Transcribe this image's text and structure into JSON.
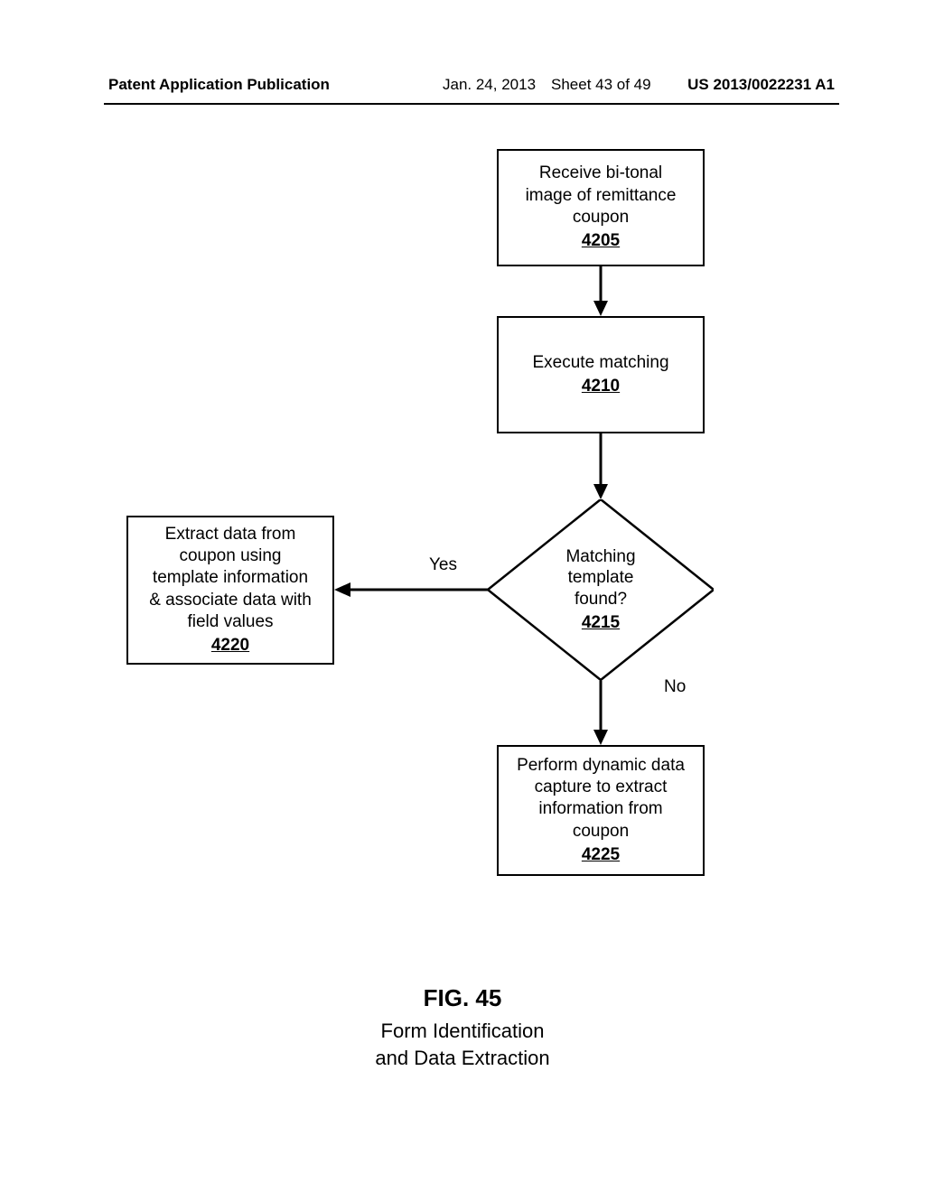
{
  "header": {
    "publication_label": "Patent Application Publication",
    "date": "Jan. 24, 2013",
    "sheet": "Sheet 43 of 49",
    "pubnum": "US 2013/0022231 A1"
  },
  "figure": {
    "number": "FIG. 45",
    "title_line1": "Form Identification",
    "title_line2": "and Data Extraction"
  },
  "boxes": {
    "b4205": {
      "text_l1": "Receive bi-tonal",
      "text_l2": "image of remittance",
      "text_l3": "coupon",
      "num": "4205"
    },
    "b4210": {
      "text_l1": "Execute matching",
      "num": "4210"
    },
    "b4220": {
      "text_l1": "Extract data from",
      "text_l2": "coupon using",
      "text_l3": "template information",
      "text_l4": "& associate data with",
      "text_l5": "field values",
      "num": "4220"
    },
    "b4225": {
      "text_l1": "Perform dynamic data",
      "text_l2": "capture to extract",
      "text_l3": "information from",
      "text_l4": "coupon",
      "num": "4225"
    }
  },
  "decision": {
    "d4215": {
      "text_l1": "Matching",
      "text_l2": "template",
      "text_l3": "found?",
      "num": "4215"
    }
  },
  "edge_labels": {
    "yes": "Yes",
    "no": "No"
  }
}
